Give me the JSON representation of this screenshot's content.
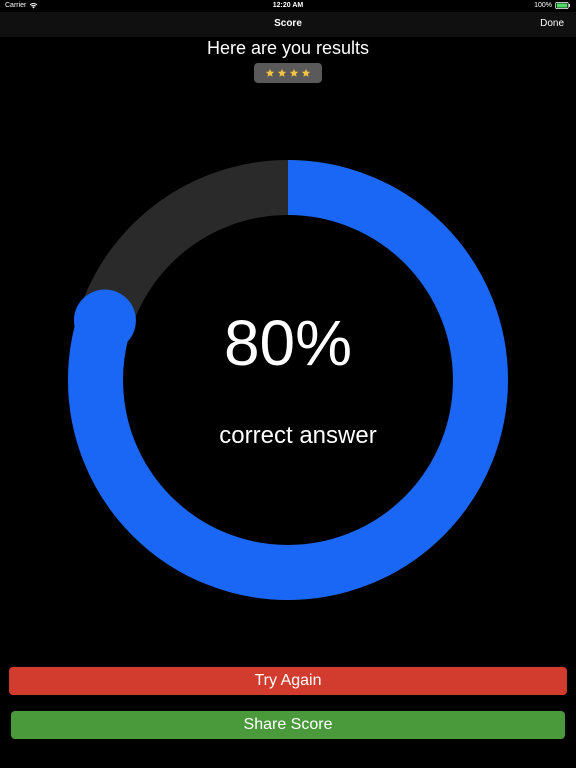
{
  "status_bar": {
    "carrier": "Carrier",
    "time": "12:20 AM",
    "battery": "100%"
  },
  "nav": {
    "title": "Score",
    "done_label": "Done"
  },
  "headline": "Here are you results",
  "rating": {
    "stars": 4,
    "icon": "star-icon",
    "star_color": "#f5c342"
  },
  "score": {
    "percent_value": 80,
    "percent_text": "80%",
    "label": "correct answer",
    "progress_color": "#1a66f5",
    "track_color": "#2a2a2a"
  },
  "buttons": {
    "try_again": "Try Again",
    "share_score": "Share Score"
  },
  "colors": {
    "try_again": "#d23c2f",
    "share_score": "#4a9a3c"
  }
}
